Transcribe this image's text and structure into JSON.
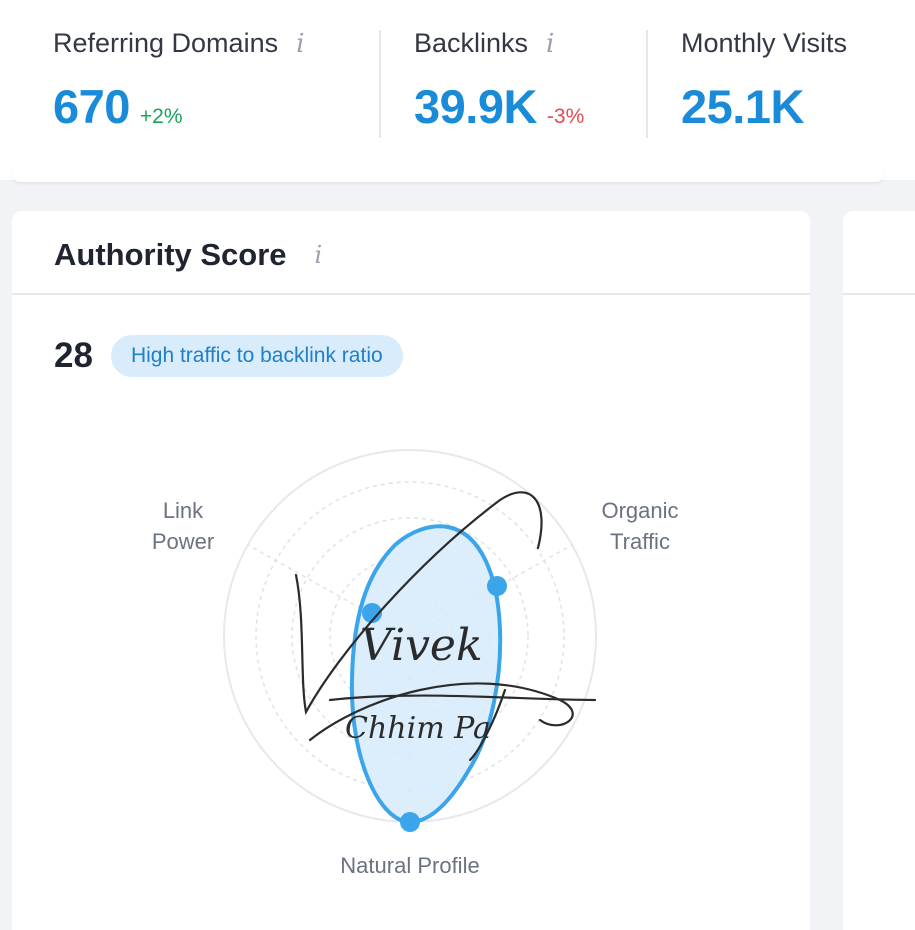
{
  "metrics": [
    {
      "label": "Referring Domains",
      "info": "i",
      "value": "670",
      "delta": "+2%",
      "trend": "up"
    },
    {
      "label": "Backlinks",
      "info": "i",
      "value": "39.9K",
      "delta": "-3%",
      "trend": "down"
    },
    {
      "label": "Monthly Visits",
      "value": "25.1K"
    }
  ],
  "authority": {
    "title": "Authority Score",
    "info": "i",
    "score": "28",
    "badge": "High traffic to backlink ratio"
  },
  "radar": {
    "axes": [
      {
        "label_line1": "Link",
        "label_line2": "Power"
      },
      {
        "label_line1": "Organic",
        "label_line2": "Traffic"
      },
      {
        "label": "Natural Profile"
      }
    ]
  },
  "signature": {
    "line1": "Vivek",
    "line2": "Chhim Pa"
  },
  "colors": {
    "accent": "#1a8bd8",
    "positive": "#1aa35b",
    "negative": "#e24c4c",
    "badge_bg": "#d8ecfb",
    "radar_fill": "#d6ebfa",
    "radar_stroke": "#3aa5ea"
  }
}
